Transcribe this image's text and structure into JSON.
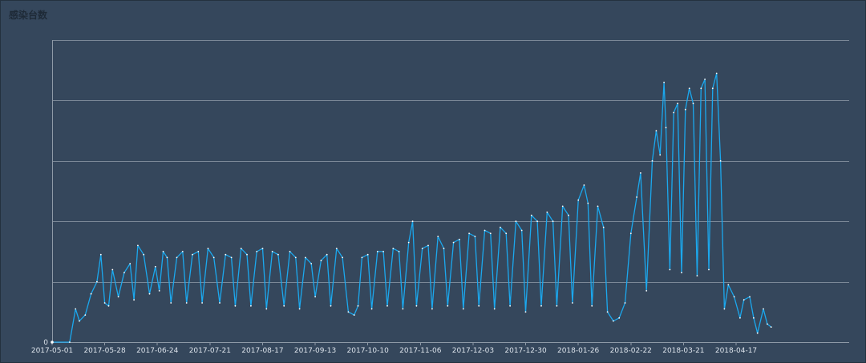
{
  "chart_data": {
    "type": "line",
    "title": "感染台数",
    "xlabel": "",
    "ylabel": "",
    "x_ticks": [
      "2017-05-01",
      "2017-05-28",
      "2017-06-24",
      "2017-07-21",
      "2017-08-17",
      "2017-09-13",
      "2017-10-10",
      "2017-11-06",
      "2017-12-03",
      "2017-12-30",
      "2018-01-26",
      "2018-02-22",
      "2018-03-21",
      "2018-04-17"
    ],
    "y_ticks": [
      "0"
    ],
    "ylim": [
      0,
      500
    ],
    "gridlines": 5,
    "grid": true,
    "series": [
      {
        "color": "#1ba8ee",
        "points": [
          [
            "2017-05-01",
            0
          ],
          [
            "2017-05-10",
            0
          ],
          [
            "2017-05-13",
            55
          ],
          [
            "2017-05-15",
            35
          ],
          [
            "2017-05-18",
            45
          ],
          [
            "2017-05-21",
            80
          ],
          [
            "2017-05-24",
            100
          ],
          [
            "2017-05-26",
            145
          ],
          [
            "2017-05-28",
            65
          ],
          [
            "2017-05-30",
            60
          ],
          [
            "2017-06-01",
            120
          ],
          [
            "2017-06-04",
            75
          ],
          [
            "2017-06-07",
            115
          ],
          [
            "2017-06-10",
            130
          ],
          [
            "2017-06-12",
            70
          ],
          [
            "2017-06-14",
            160
          ],
          [
            "2017-06-17",
            145
          ],
          [
            "2017-06-20",
            80
          ],
          [
            "2017-06-23",
            125
          ],
          [
            "2017-06-25",
            85
          ],
          [
            "2017-06-27",
            150
          ],
          [
            "2017-06-29",
            140
          ],
          [
            "2017-07-01",
            65
          ],
          [
            "2017-07-04",
            140
          ],
          [
            "2017-07-07",
            150
          ],
          [
            "2017-07-09",
            65
          ],
          [
            "2017-07-12",
            145
          ],
          [
            "2017-07-15",
            150
          ],
          [
            "2017-07-17",
            65
          ],
          [
            "2017-07-20",
            155
          ],
          [
            "2017-07-23",
            140
          ],
          [
            "2017-07-26",
            65
          ],
          [
            "2017-07-29",
            145
          ],
          [
            "2017-08-01",
            140
          ],
          [
            "2017-08-03",
            60
          ],
          [
            "2017-08-06",
            155
          ],
          [
            "2017-08-09",
            145
          ],
          [
            "2017-08-11",
            60
          ],
          [
            "2017-08-14",
            150
          ],
          [
            "2017-08-17",
            155
          ],
          [
            "2017-08-19",
            55
          ],
          [
            "2017-08-22",
            150
          ],
          [
            "2017-08-25",
            145
          ],
          [
            "2017-08-28",
            60
          ],
          [
            "2017-08-31",
            150
          ],
          [
            "2017-09-03",
            140
          ],
          [
            "2017-09-05",
            55
          ],
          [
            "2017-09-08",
            140
          ],
          [
            "2017-09-11",
            130
          ],
          [
            "2017-09-13",
            75
          ],
          [
            "2017-09-16",
            135
          ],
          [
            "2017-09-19",
            145
          ],
          [
            "2017-09-21",
            60
          ],
          [
            "2017-09-24",
            155
          ],
          [
            "2017-09-27",
            140
          ],
          [
            "2017-09-30",
            50
          ],
          [
            "2017-10-03",
            45
          ],
          [
            "2017-10-05",
            60
          ],
          [
            "2017-10-07",
            140
          ],
          [
            "2017-10-10",
            145
          ],
          [
            "2017-10-12",
            55
          ],
          [
            "2017-10-15",
            150
          ],
          [
            "2017-10-18",
            150
          ],
          [
            "2017-10-20",
            60
          ],
          [
            "2017-10-23",
            155
          ],
          [
            "2017-10-26",
            150
          ],
          [
            "2017-10-28",
            55
          ],
          [
            "2017-10-31",
            165
          ],
          [
            "2017-11-02",
            200
          ],
          [
            "2017-11-04",
            60
          ],
          [
            "2017-11-07",
            155
          ],
          [
            "2017-11-10",
            160
          ],
          [
            "2017-11-12",
            55
          ],
          [
            "2017-11-15",
            175
          ],
          [
            "2017-11-18",
            155
          ],
          [
            "2017-11-20",
            60
          ],
          [
            "2017-11-23",
            165
          ],
          [
            "2017-11-26",
            170
          ],
          [
            "2017-11-28",
            55
          ],
          [
            "2017-12-01",
            180
          ],
          [
            "2017-12-04",
            175
          ],
          [
            "2017-12-06",
            60
          ],
          [
            "2017-12-09",
            185
          ],
          [
            "2017-12-12",
            180
          ],
          [
            "2017-12-14",
            55
          ],
          [
            "2017-12-17",
            190
          ],
          [
            "2017-12-20",
            180
          ],
          [
            "2017-12-22",
            60
          ],
          [
            "2017-12-25",
            200
          ],
          [
            "2017-12-28",
            185
          ],
          [
            "2017-12-30",
            50
          ],
          [
            "2018-01-02",
            210
          ],
          [
            "2018-01-05",
            200
          ],
          [
            "2018-01-07",
            60
          ],
          [
            "2018-01-10",
            215
          ],
          [
            "2018-01-13",
            200
          ],
          [
            "2018-01-15",
            60
          ],
          [
            "2018-01-18",
            225
          ],
          [
            "2018-01-21",
            210
          ],
          [
            "2018-01-23",
            65
          ],
          [
            "2018-01-26",
            235
          ],
          [
            "2018-01-29",
            260
          ],
          [
            "2018-01-31",
            230
          ],
          [
            "2018-02-02",
            60
          ],
          [
            "2018-02-05",
            225
          ],
          [
            "2018-02-08",
            190
          ],
          [
            "2018-02-10",
            50
          ],
          [
            "2018-02-13",
            35
          ],
          [
            "2018-02-16",
            40
          ],
          [
            "2018-02-19",
            65
          ],
          [
            "2018-02-22",
            180
          ],
          [
            "2018-02-25",
            240
          ],
          [
            "2018-02-27",
            280
          ],
          [
            "2018-03-02",
            85
          ],
          [
            "2018-03-05",
            300
          ],
          [
            "2018-03-07",
            350
          ],
          [
            "2018-03-09",
            310
          ],
          [
            "2018-03-11",
            430
          ],
          [
            "2018-03-12",
            355
          ],
          [
            "2018-03-14",
            120
          ],
          [
            "2018-03-16",
            380
          ],
          [
            "2018-03-18",
            395
          ],
          [
            "2018-03-20",
            115
          ],
          [
            "2018-03-22",
            385
          ],
          [
            "2018-03-24",
            420
          ],
          [
            "2018-03-26",
            395
          ],
          [
            "2018-03-28",
            110
          ],
          [
            "2018-03-30",
            420
          ],
          [
            "2018-04-01",
            435
          ],
          [
            "2018-04-03",
            120
          ],
          [
            "2018-04-05",
            420
          ],
          [
            "2018-04-07",
            445
          ],
          [
            "2018-04-09",
            300
          ],
          [
            "2018-04-11",
            55
          ],
          [
            "2018-04-13",
            95
          ],
          [
            "2018-04-16",
            75
          ],
          [
            "2018-04-19",
            40
          ],
          [
            "2018-04-21",
            70
          ],
          [
            "2018-04-24",
            75
          ],
          [
            "2018-04-26",
            40
          ],
          [
            "2018-04-28",
            15
          ],
          [
            "2018-05-01",
            55
          ],
          [
            "2018-05-03",
            30
          ],
          [
            "2018-05-05",
            25
          ]
        ]
      }
    ]
  }
}
